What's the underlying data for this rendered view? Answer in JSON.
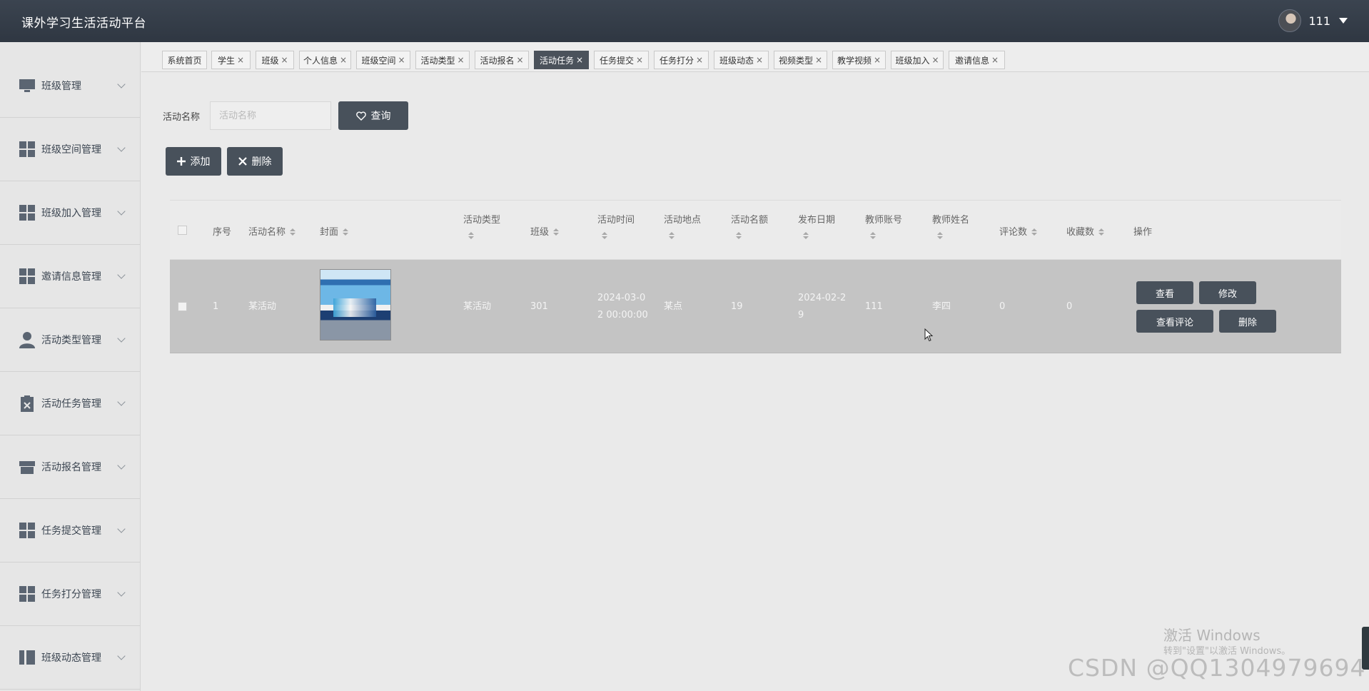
{
  "app": {
    "title": "课外学习生活活动平台",
    "user": "111"
  },
  "sidebar": {
    "items": [
      {
        "label": "班级管理",
        "icon": "monitor-icon"
      },
      {
        "label": "班级空间管理",
        "icon": "grid-icon"
      },
      {
        "label": "班级加入管理",
        "icon": "grid-icon"
      },
      {
        "label": "邀请信息管理",
        "icon": "grid-icon"
      },
      {
        "label": "活动类型管理",
        "icon": "user-icon"
      },
      {
        "label": "活动任务管理",
        "icon": "clipboard-icon"
      },
      {
        "label": "活动报名管理",
        "icon": "store-icon"
      },
      {
        "label": "任务提交管理",
        "icon": "grid-icon"
      },
      {
        "label": "任务打分管理",
        "icon": "grid-icon"
      },
      {
        "label": "班级动态管理",
        "icon": "book-icon"
      }
    ]
  },
  "tabs": [
    {
      "label": "系统首页",
      "closable": false
    },
    {
      "label": "学生",
      "closable": true
    },
    {
      "label": "班级",
      "closable": true
    },
    {
      "label": "个人信息",
      "closable": true
    },
    {
      "label": "班级空间",
      "closable": true
    },
    {
      "label": "活动类型",
      "closable": true
    },
    {
      "label": "活动报名",
      "closable": true
    },
    {
      "label": "活动任务",
      "closable": true,
      "active": true
    },
    {
      "label": "任务提交",
      "closable": true
    },
    {
      "label": "任务打分",
      "closable": true
    },
    {
      "label": "班级动态",
      "closable": true
    },
    {
      "label": "视频类型",
      "closable": true
    },
    {
      "label": "教学视频",
      "closable": true
    },
    {
      "label": "班级加入",
      "closable": true
    },
    {
      "label": "邀请信息",
      "closable": true
    }
  ],
  "tab_close_glyph": "×",
  "search": {
    "label": "活动名称",
    "placeholder": "活动名称",
    "value": "",
    "button": "查询"
  },
  "actions": {
    "add": "添加",
    "delete": "删除"
  },
  "table": {
    "columns": {
      "index": "序号",
      "name": "活动名称",
      "cover": "封面",
      "type": "活动类型",
      "class": "班级",
      "time": "活动时间",
      "place": "活动地点",
      "quota": "活动名额",
      "date": "发布日期",
      "teacher_account": "教师账号",
      "teacher_name": "教师姓名",
      "comments": "评论数",
      "favorites": "收藏数",
      "ops": "操作"
    },
    "rows": [
      {
        "index": "1",
        "name": "某活动",
        "type": "某活动",
        "class": "301",
        "time_line1": "2024-03-0",
        "time_line2": "2 00:00:00",
        "place": "某点",
        "quota": "19",
        "date_line1": "2024-02-2",
        "date_line2": "9",
        "teacher_account": "111",
        "teacher_name": "李四",
        "comments": "0",
        "favorites": "0"
      }
    ],
    "row_buttons": {
      "view": "查看",
      "edit": "修改",
      "view_comments": "查看评论",
      "delete": "删除"
    }
  },
  "watermark": {
    "activate_title": "激活 Windows",
    "activate_sub": "转到\"设置\"以激活 Windows。",
    "csdn": "CSDN @QQ1304979694"
  },
  "colors": {
    "header": "#333b45",
    "button": "#48515b",
    "row_selected": "#c4c4c4",
    "background": "#eaeaea"
  }
}
